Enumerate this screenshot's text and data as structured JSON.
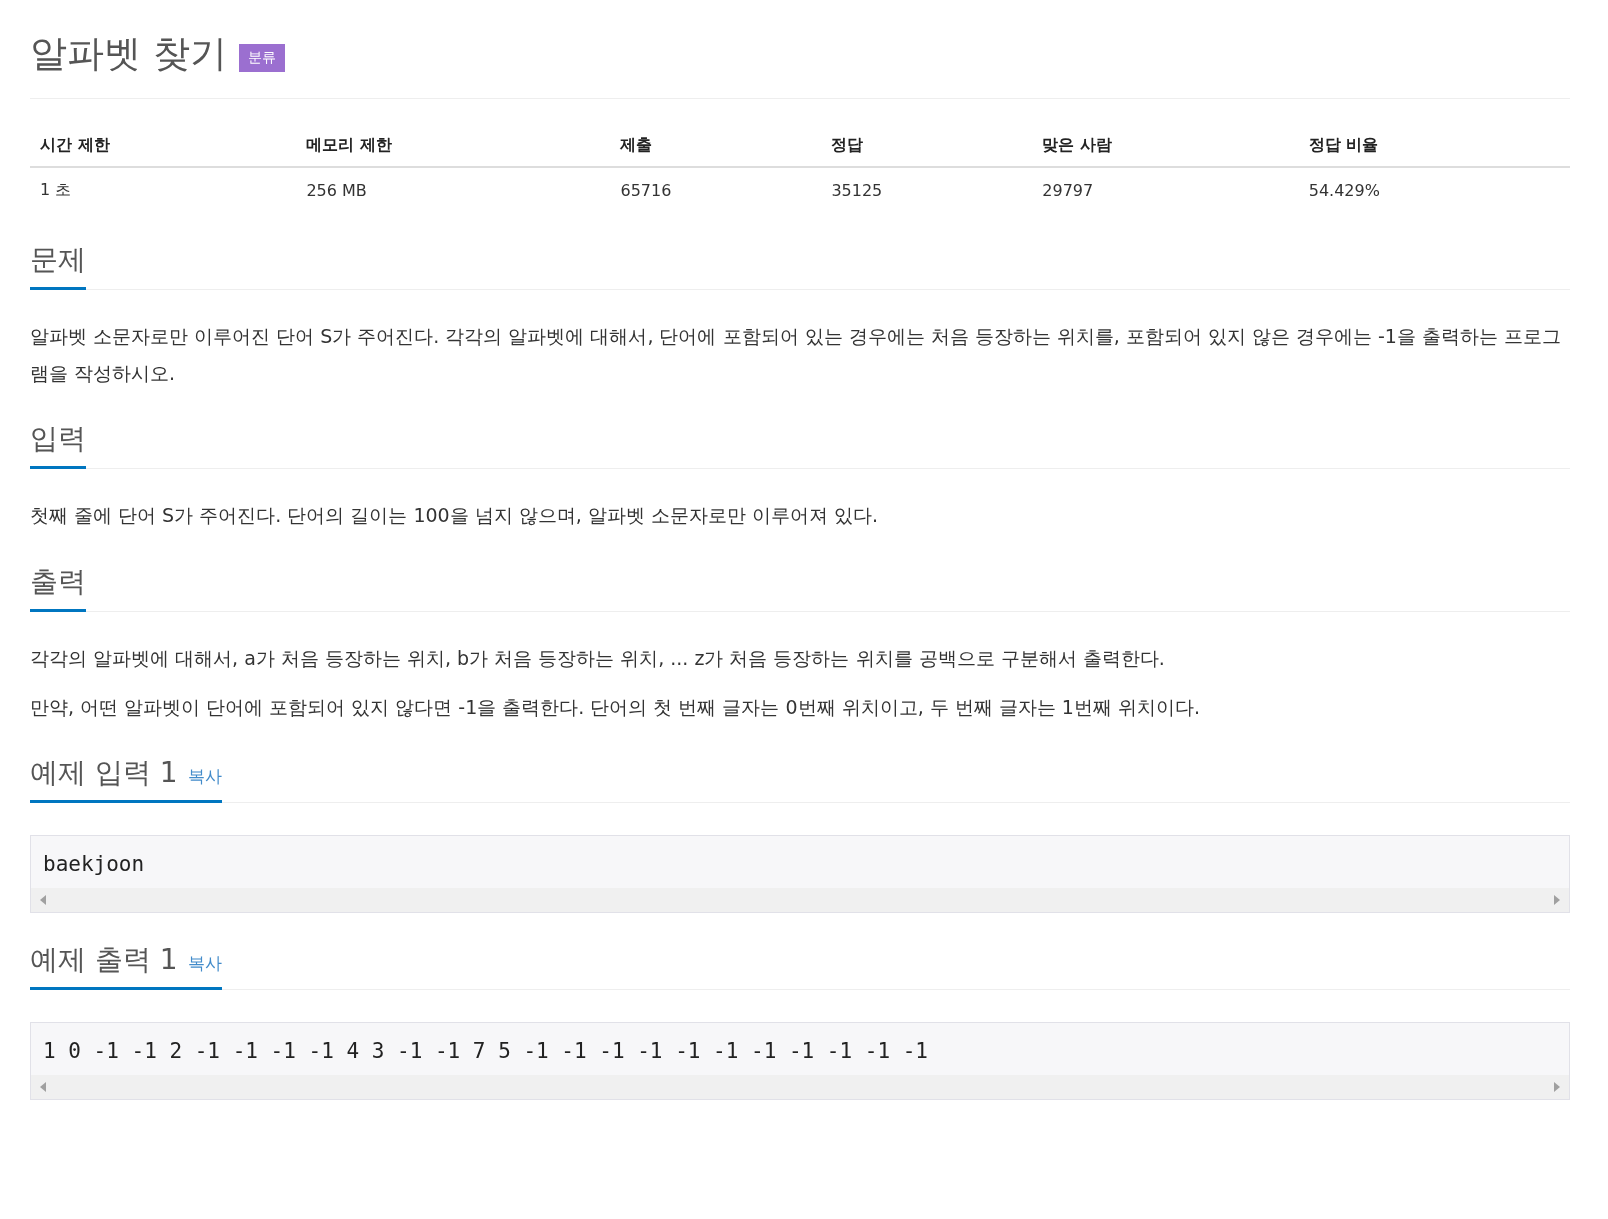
{
  "title": "알파벳 찾기",
  "badge": "분류",
  "stats": {
    "columns": [
      "시간 제한",
      "메모리 제한",
      "제출",
      "정답",
      "맞은 사람",
      "정답 비율"
    ],
    "row": [
      "1 초",
      "256 MB",
      "65716",
      "35125",
      "29797",
      "54.429%"
    ]
  },
  "sections": [
    {
      "kind": "text",
      "heading": "문제",
      "paragraphs": [
        "알파벳 소문자로만 이루어진 단어 S가 주어진다. 각각의 알파벳에 대해서, 단어에 포함되어 있는 경우에는 처음 등장하는 위치를, 포함되어 있지 않은 경우에는 -1을 출력하는 프로그램을 작성하시오."
      ]
    },
    {
      "kind": "text",
      "heading": "입력",
      "paragraphs": [
        "첫째 줄에 단어 S가 주어진다. 단어의 길이는 100을 넘지 않으며, 알파벳 소문자로만 이루어져 있다."
      ]
    },
    {
      "kind": "text",
      "heading": "출력",
      "paragraphs": [
        "각각의 알파벳에 대해서, a가 처음 등장하는 위치, b가 처음 등장하는 위치, ... z가 처음 등장하는 위치를 공백으로 구분해서 출력한다.",
        "만약, 어떤 알파벳이 단어에 포함되어 있지 않다면 -1을 출력한다. 단어의 첫 번째 글자는 0번째 위치이고, 두 번째 글자는 1번째 위치이다."
      ]
    },
    {
      "kind": "sample",
      "heading": "예제 입력 1",
      "copy": "복사",
      "code": "baekjoon"
    },
    {
      "kind": "sample",
      "heading": "예제 출력 1",
      "copy": "복사",
      "code": "1 0 -1 -1 2 -1 -1 -1 -1 4 3 -1 -1 7 5 -1 -1 -1 -1 -1 -1 -1 -1 -1 -1 -1"
    }
  ]
}
